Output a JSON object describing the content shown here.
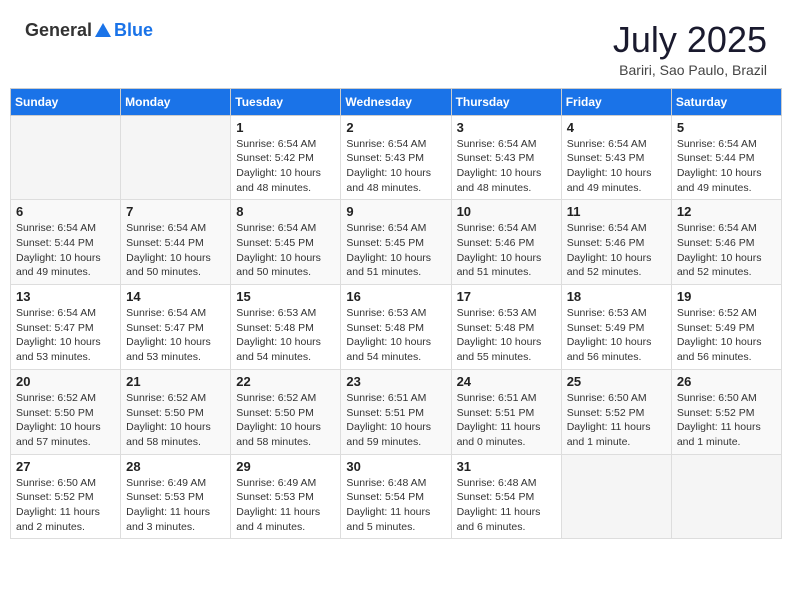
{
  "header": {
    "logo_general": "General",
    "logo_blue": "Blue",
    "month_title": "July 2025",
    "location": "Bariri, Sao Paulo, Brazil"
  },
  "weekdays": [
    "Sunday",
    "Monday",
    "Tuesday",
    "Wednesday",
    "Thursday",
    "Friday",
    "Saturday"
  ],
  "weeks": [
    [
      {
        "day": "",
        "empty": true
      },
      {
        "day": "",
        "empty": true
      },
      {
        "day": "1",
        "sunrise": "Sunrise: 6:54 AM",
        "sunset": "Sunset: 5:42 PM",
        "daylight": "Daylight: 10 hours and 48 minutes."
      },
      {
        "day": "2",
        "sunrise": "Sunrise: 6:54 AM",
        "sunset": "Sunset: 5:43 PM",
        "daylight": "Daylight: 10 hours and 48 minutes."
      },
      {
        "day": "3",
        "sunrise": "Sunrise: 6:54 AM",
        "sunset": "Sunset: 5:43 PM",
        "daylight": "Daylight: 10 hours and 48 minutes."
      },
      {
        "day": "4",
        "sunrise": "Sunrise: 6:54 AM",
        "sunset": "Sunset: 5:43 PM",
        "daylight": "Daylight: 10 hours and 49 minutes."
      },
      {
        "day": "5",
        "sunrise": "Sunrise: 6:54 AM",
        "sunset": "Sunset: 5:44 PM",
        "daylight": "Daylight: 10 hours and 49 minutes."
      }
    ],
    [
      {
        "day": "6",
        "sunrise": "Sunrise: 6:54 AM",
        "sunset": "Sunset: 5:44 PM",
        "daylight": "Daylight: 10 hours and 49 minutes."
      },
      {
        "day": "7",
        "sunrise": "Sunrise: 6:54 AM",
        "sunset": "Sunset: 5:44 PM",
        "daylight": "Daylight: 10 hours and 50 minutes."
      },
      {
        "day": "8",
        "sunrise": "Sunrise: 6:54 AM",
        "sunset": "Sunset: 5:45 PM",
        "daylight": "Daylight: 10 hours and 50 minutes."
      },
      {
        "day": "9",
        "sunrise": "Sunrise: 6:54 AM",
        "sunset": "Sunset: 5:45 PM",
        "daylight": "Daylight: 10 hours and 51 minutes."
      },
      {
        "day": "10",
        "sunrise": "Sunrise: 6:54 AM",
        "sunset": "Sunset: 5:46 PM",
        "daylight": "Daylight: 10 hours and 51 minutes."
      },
      {
        "day": "11",
        "sunrise": "Sunrise: 6:54 AM",
        "sunset": "Sunset: 5:46 PM",
        "daylight": "Daylight: 10 hours and 52 minutes."
      },
      {
        "day": "12",
        "sunrise": "Sunrise: 6:54 AM",
        "sunset": "Sunset: 5:46 PM",
        "daylight": "Daylight: 10 hours and 52 minutes."
      }
    ],
    [
      {
        "day": "13",
        "sunrise": "Sunrise: 6:54 AM",
        "sunset": "Sunset: 5:47 PM",
        "daylight": "Daylight: 10 hours and 53 minutes."
      },
      {
        "day": "14",
        "sunrise": "Sunrise: 6:54 AM",
        "sunset": "Sunset: 5:47 PM",
        "daylight": "Daylight: 10 hours and 53 minutes."
      },
      {
        "day": "15",
        "sunrise": "Sunrise: 6:53 AM",
        "sunset": "Sunset: 5:48 PM",
        "daylight": "Daylight: 10 hours and 54 minutes."
      },
      {
        "day": "16",
        "sunrise": "Sunrise: 6:53 AM",
        "sunset": "Sunset: 5:48 PM",
        "daylight": "Daylight: 10 hours and 54 minutes."
      },
      {
        "day": "17",
        "sunrise": "Sunrise: 6:53 AM",
        "sunset": "Sunset: 5:48 PM",
        "daylight": "Daylight: 10 hours and 55 minutes."
      },
      {
        "day": "18",
        "sunrise": "Sunrise: 6:53 AM",
        "sunset": "Sunset: 5:49 PM",
        "daylight": "Daylight: 10 hours and 56 minutes."
      },
      {
        "day": "19",
        "sunrise": "Sunrise: 6:52 AM",
        "sunset": "Sunset: 5:49 PM",
        "daylight": "Daylight: 10 hours and 56 minutes."
      }
    ],
    [
      {
        "day": "20",
        "sunrise": "Sunrise: 6:52 AM",
        "sunset": "Sunset: 5:50 PM",
        "daylight": "Daylight: 10 hours and 57 minutes."
      },
      {
        "day": "21",
        "sunrise": "Sunrise: 6:52 AM",
        "sunset": "Sunset: 5:50 PM",
        "daylight": "Daylight: 10 hours and 58 minutes."
      },
      {
        "day": "22",
        "sunrise": "Sunrise: 6:52 AM",
        "sunset": "Sunset: 5:50 PM",
        "daylight": "Daylight: 10 hours and 58 minutes."
      },
      {
        "day": "23",
        "sunrise": "Sunrise: 6:51 AM",
        "sunset": "Sunset: 5:51 PM",
        "daylight": "Daylight: 10 hours and 59 minutes."
      },
      {
        "day": "24",
        "sunrise": "Sunrise: 6:51 AM",
        "sunset": "Sunset: 5:51 PM",
        "daylight": "Daylight: 11 hours and 0 minutes."
      },
      {
        "day": "25",
        "sunrise": "Sunrise: 6:50 AM",
        "sunset": "Sunset: 5:52 PM",
        "daylight": "Daylight: 11 hours and 1 minute."
      },
      {
        "day": "26",
        "sunrise": "Sunrise: 6:50 AM",
        "sunset": "Sunset: 5:52 PM",
        "daylight": "Daylight: 11 hours and 1 minute."
      }
    ],
    [
      {
        "day": "27",
        "sunrise": "Sunrise: 6:50 AM",
        "sunset": "Sunset: 5:52 PM",
        "daylight": "Daylight: 11 hours and 2 minutes."
      },
      {
        "day": "28",
        "sunrise": "Sunrise: 6:49 AM",
        "sunset": "Sunset: 5:53 PM",
        "daylight": "Daylight: 11 hours and 3 minutes."
      },
      {
        "day": "29",
        "sunrise": "Sunrise: 6:49 AM",
        "sunset": "Sunset: 5:53 PM",
        "daylight": "Daylight: 11 hours and 4 minutes."
      },
      {
        "day": "30",
        "sunrise": "Sunrise: 6:48 AM",
        "sunset": "Sunset: 5:54 PM",
        "daylight": "Daylight: 11 hours and 5 minutes."
      },
      {
        "day": "31",
        "sunrise": "Sunrise: 6:48 AM",
        "sunset": "Sunset: 5:54 PM",
        "daylight": "Daylight: 11 hours and 6 minutes."
      },
      {
        "day": "",
        "empty": true
      },
      {
        "day": "",
        "empty": true
      }
    ]
  ]
}
